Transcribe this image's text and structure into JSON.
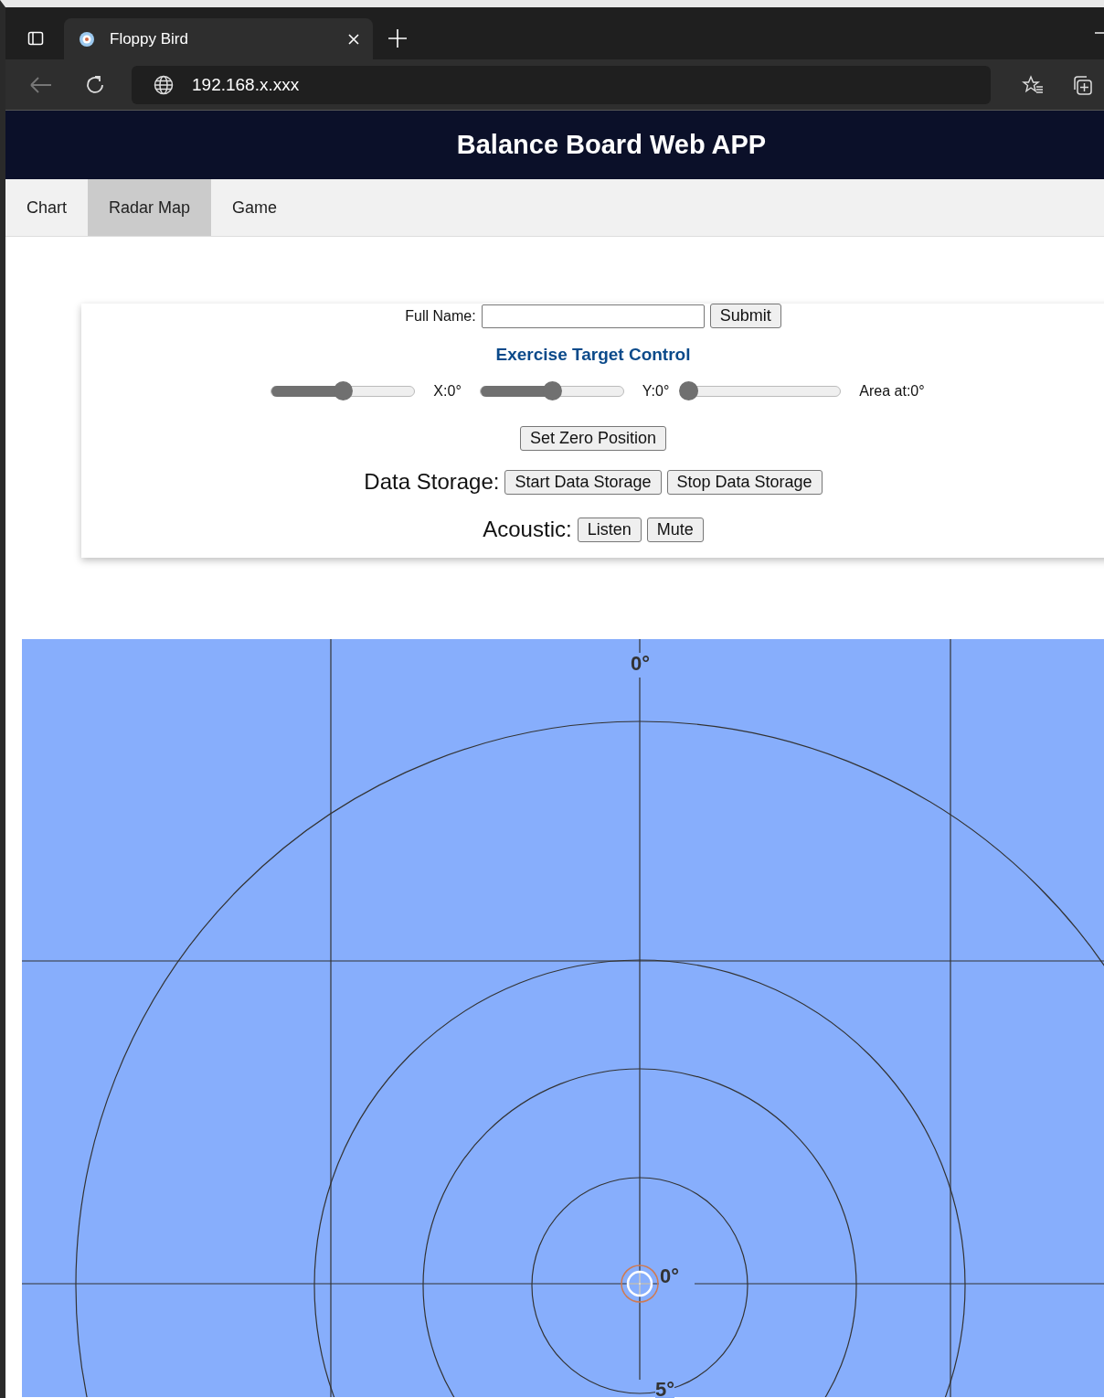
{
  "browser": {
    "tab_title": "Floppy Bird",
    "address": "192.168.x.xxx"
  },
  "header": {
    "title": "Balance Board Web APP"
  },
  "nav": [
    {
      "label": "Chart",
      "selected": false
    },
    {
      "label": "Radar Map",
      "selected": true
    },
    {
      "label": "Game",
      "selected": false
    }
  ],
  "form": {
    "name_label": "Full Name:",
    "submit": "Submit"
  },
  "target_control": {
    "title": "Exercise Target Control",
    "sliders": [
      {
        "label": "X:0°",
        "level": 0.5
      },
      {
        "label": "Y:0°",
        "level": 0.5
      },
      {
        "label": "Area at:0°",
        "level": 0
      }
    ],
    "zero_button": "Set Zero Position"
  },
  "data_storage": {
    "label": "Data Storage:",
    "buttons": [
      "Start Data Storage",
      "Stop Data Storage"
    ]
  },
  "acoustic": {
    "label": "Acoustic:",
    "buttons": [
      "Listen",
      "Mute"
    ]
  },
  "radar": {
    "top_label": "0°",
    "center_label": "0°",
    "bottom_label": "5°"
  }
}
